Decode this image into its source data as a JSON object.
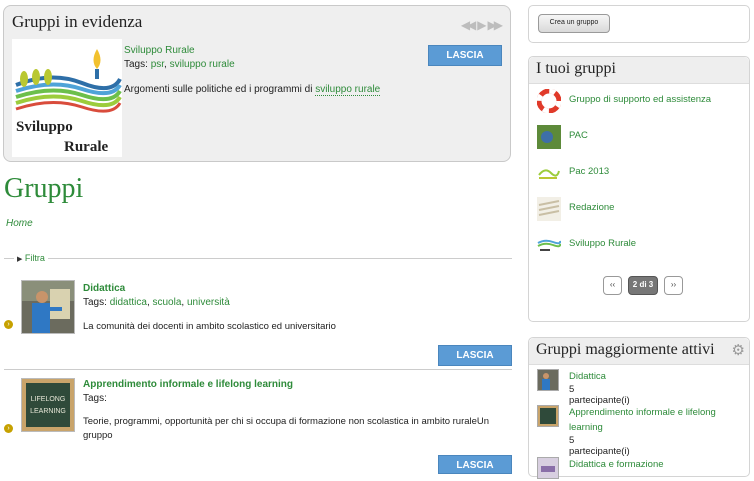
{
  "featured": {
    "title": "Gruppi in evidenza",
    "logo_text_line1": "Sviluppo",
    "logo_text_line2": "Rurale",
    "group_name": "Sviluppo Rurale",
    "tags_label": "Tags:",
    "tags": [
      "psr",
      "sviluppo rurale"
    ],
    "description_prefix": "Argomenti sulle politiche ed i programmi di",
    "description_link": "sviluppo rurale",
    "leave_label": "LASCIA"
  },
  "page_title": "Gruppi",
  "breadcrumb": "Home",
  "filter_label": "Filtra",
  "groups": [
    {
      "name": "Didattica",
      "tags_label": "Tags:",
      "tags": [
        "didattica",
        "scuola",
        "università"
      ],
      "description": "La comunità dei docenti in ambito scolastico ed universitario",
      "leave_label": "LASCIA"
    },
    {
      "name": "Apprendimento informale e lifelong learning",
      "tags_label": "Tags:",
      "tags": [],
      "description": "Teorie, programmi, opportunità per chi si occupa di formazione non scolastica in ambito ruraleUn gruppo",
      "leave_label": "LASCIA"
    }
  ],
  "sidebar": {
    "create_button": "Crea un gruppo",
    "my_groups": {
      "title": "I tuoi gruppi",
      "items": [
        {
          "name": "Gruppo di supporto ed assistenza",
          "icon": "lifebuoy-icon"
        },
        {
          "name": "PAC",
          "icon": "pac-icon"
        },
        {
          "name": "Pac 2013",
          "icon": "pac2013-icon"
        },
        {
          "name": "Redazione",
          "icon": "redazione-icon"
        },
        {
          "name": "Sviluppo Rurale",
          "icon": "sviluppo-rurale-icon"
        }
      ],
      "pager": {
        "prev": "‹‹",
        "current": "2 di 3",
        "next": "››"
      }
    },
    "most_active": {
      "title": "Gruppi maggiormente attivi",
      "items": [
        {
          "name": "Didattica",
          "count": "5 partecipante(i)"
        },
        {
          "name": "Apprendimento informale e lifelong learning",
          "count": "5 partecipante(i)"
        },
        {
          "name": "Didattica e formazione",
          "count": ""
        }
      ]
    }
  },
  "colors": {
    "accent_green": "#2e8b3a",
    "button_blue": "#5b9bd5",
    "bullet_gold": "#c6a100"
  }
}
